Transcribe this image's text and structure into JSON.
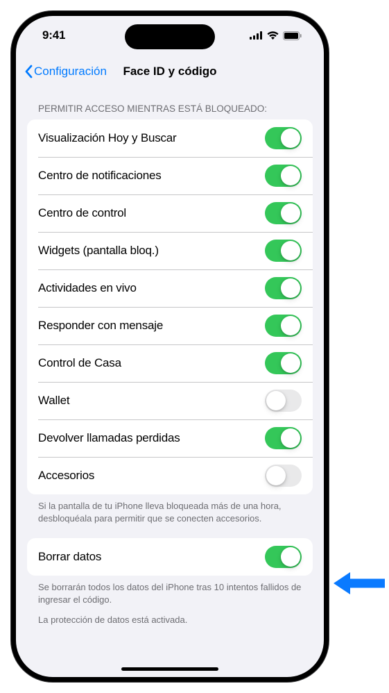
{
  "status_bar": {
    "time": "9:41"
  },
  "nav": {
    "back_label": "Configuración",
    "title": "Face ID y código"
  },
  "section1": {
    "header": "PERMITIR ACCESO MIENTRAS ESTÁ BLOQUEADO:",
    "rows": [
      {
        "label": "Visualización Hoy y Buscar",
        "on": true
      },
      {
        "label": "Centro de notificaciones",
        "on": true
      },
      {
        "label": "Centro de control",
        "on": true
      },
      {
        "label": "Widgets (pantalla bloq.)",
        "on": true
      },
      {
        "label": "Actividades en vivo",
        "on": true
      },
      {
        "label": "Responder con mensaje",
        "on": true
      },
      {
        "label": "Control de Casa",
        "on": true
      },
      {
        "label": "Wallet",
        "on": false
      },
      {
        "label": "Devolver llamadas perdidas",
        "on": true
      },
      {
        "label": "Accesorios",
        "on": false
      }
    ],
    "footer": "Si la pantalla de tu iPhone lleva bloqueada más de una hora, desbloquéala para permitir que se conecten accesorios."
  },
  "section2": {
    "rows": [
      {
        "label": "Borrar datos",
        "on": true
      }
    ],
    "footer1": "Se borrarán todos los datos del iPhone tras 10 intentos fallidos de ingresar el código.",
    "footer2": "La protección de datos está activada."
  },
  "callout": {
    "color": "#0a7aff"
  }
}
